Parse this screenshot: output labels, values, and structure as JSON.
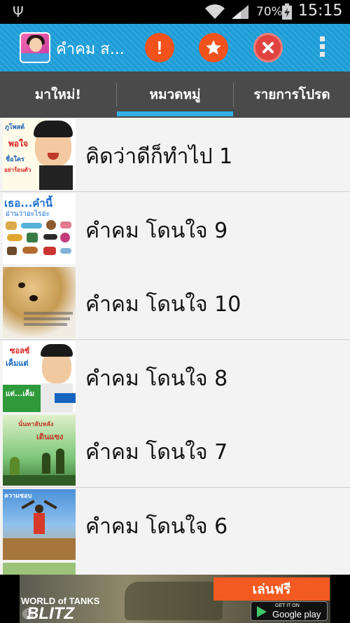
{
  "status_bar": {
    "usb_icon": "usb-icon",
    "wifi_icon": "wifi-icon",
    "signal_icon": "signal-icon",
    "battery_percent": "70%",
    "battery_icon": "battery-charging-icon",
    "time": "15:15"
  },
  "action_bar": {
    "title": "คำคม ส...",
    "icons": [
      "app-icon",
      "alert-icon",
      "star-icon",
      "close-icon",
      "overflow-menu-icon"
    ],
    "colors": {
      "background": "#1d9dd8",
      "button": "#f3521d"
    }
  },
  "tabs": [
    {
      "label": "มาใหม่!",
      "selected": false
    },
    {
      "label": "หมวดหมู่",
      "selected": true
    },
    {
      "label": "รายการโปรด",
      "selected": false
    }
  ],
  "list": {
    "items": [
      {
        "label": "คิดว่าดีก็ทำไป 1",
        "thumb_text": [
          "ภูโพสต์",
          "พอใจ",
          "ชื่อใคร",
          "อย่าร้อนตัว"
        ]
      },
      {
        "label": "คำคม โดนใจ 9",
        "thumb_text": [
          "เธอ...คำนี้",
          "อ่านว่าอะไรอ่ะ"
        ]
      },
      {
        "label": "คำคม โดนใจ 10",
        "thumb_text": []
      },
      {
        "label": "คำคม โดนใจ 8",
        "thumb_text": [
          "ซอลซ์",
          "เค็มแต่",
          "แต่...เค็ม"
        ]
      },
      {
        "label": "คำคม โดนใจ 7",
        "thumb_text": [
          "นั่นทาลับหลัง",
          "เดินแซง"
        ]
      },
      {
        "label": "คำคม โดนใจ 6",
        "thumb_text": [
          "ความชอบ"
        ]
      }
    ]
  },
  "ad": {
    "brand_top": "WORLD of TANKS",
    "brand_big": "BLITZ",
    "cta": "เล่นฟรี",
    "store_small": "GET IT ON",
    "store_big": "Google play",
    "info": "i"
  }
}
